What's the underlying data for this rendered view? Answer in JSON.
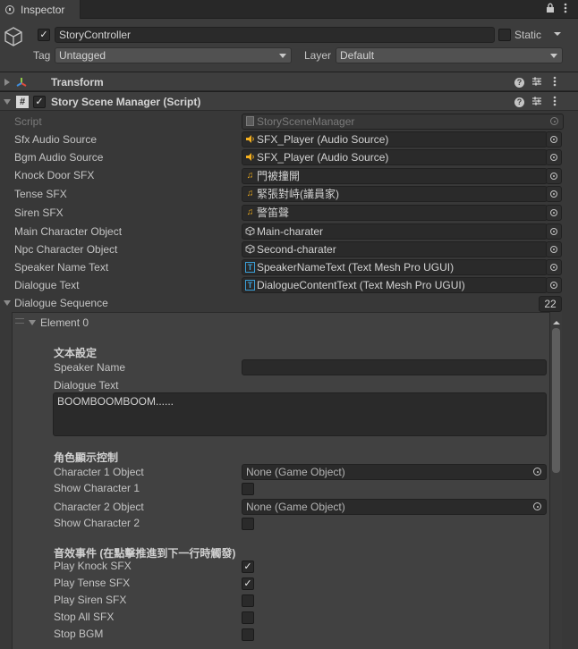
{
  "tab": {
    "title": "Inspector"
  },
  "header": {
    "object_name": "StoryController",
    "static_label": "Static",
    "tag_label": "Tag",
    "tag_value": "Untagged",
    "layer_label": "Layer",
    "layer_value": "Default"
  },
  "components": {
    "transform_title": "Transform",
    "script_title": "Story Scene Manager (Script)"
  },
  "properties": [
    {
      "label": "Script",
      "value": "StorySceneManager",
      "icon": "script-icon"
    },
    {
      "label": "Sfx Audio Source",
      "value": "SFX_Player (Audio Source)",
      "icon": "audio-source-icon"
    },
    {
      "label": "Bgm Audio Source",
      "value": "SFX_Player (Audio Source)",
      "icon": "audio-source-icon"
    },
    {
      "label": "Knock Door SFX",
      "value": "門被撞開",
      "icon": "audio-clip-icon"
    },
    {
      "label": "Tense SFX",
      "value": "緊張對峙(議員家)",
      "icon": "audio-clip-icon"
    },
    {
      "label": "Siren SFX",
      "value": "警笛聲",
      "icon": "audio-clip-icon"
    },
    {
      "label": "Main Character Object",
      "value": "Main-charater",
      "icon": "game-object-icon"
    },
    {
      "label": "Npc Character Object",
      "value": "Second-charater",
      "icon": "game-object-icon"
    },
    {
      "label": "Speaker Name Text",
      "value": "SpeakerNameText (Text Mesh Pro UGUI)",
      "icon": "tmp-text-icon"
    },
    {
      "label": "Dialogue Text",
      "value": "DialogueContentText (Text Mesh Pro UGUI)",
      "icon": "tmp-text-icon"
    }
  ],
  "dialogue_sequence": {
    "label": "Dialogue Sequence",
    "count": "22",
    "element_label": "Element 0",
    "text_settings_title": "文本設定",
    "speaker_name_label": "Speaker Name",
    "speaker_name_value": "",
    "dialogue_text_label": "Dialogue Text",
    "dialogue_text_value": "BOOMBOOMBOOM......",
    "character_title": "角色顯示控制",
    "char1_label": "Character 1 Object",
    "char1_value": "None (Game Object)",
    "show_char1_label": "Show Character 1",
    "char2_label": "Character 2 Object",
    "char2_value": "None (Game Object)",
    "show_char2_label": "Show Character 2",
    "sfx_title": "音效事件 (在點擊推進到下一行時觸發)",
    "play_knock_label": "Play Knock SFX",
    "play_tense_label": "Play Tense SFX",
    "play_siren_label": "Play Siren SFX",
    "stop_all_label": "Stop All SFX",
    "stop_bgm_label": "Stop BGM"
  },
  "checks": {
    "show_char1": false,
    "show_char2": false,
    "play_knock": true,
    "play_tense": true,
    "play_siren": false,
    "stop_all": false,
    "stop_bgm": false
  },
  "colors": {
    "background": "#383838",
    "field": "#2a2a2a",
    "transform_icon": "multicolor-axes",
    "audio_icon": "#f5b01e",
    "tmp_icon": "#3b9fd6"
  }
}
